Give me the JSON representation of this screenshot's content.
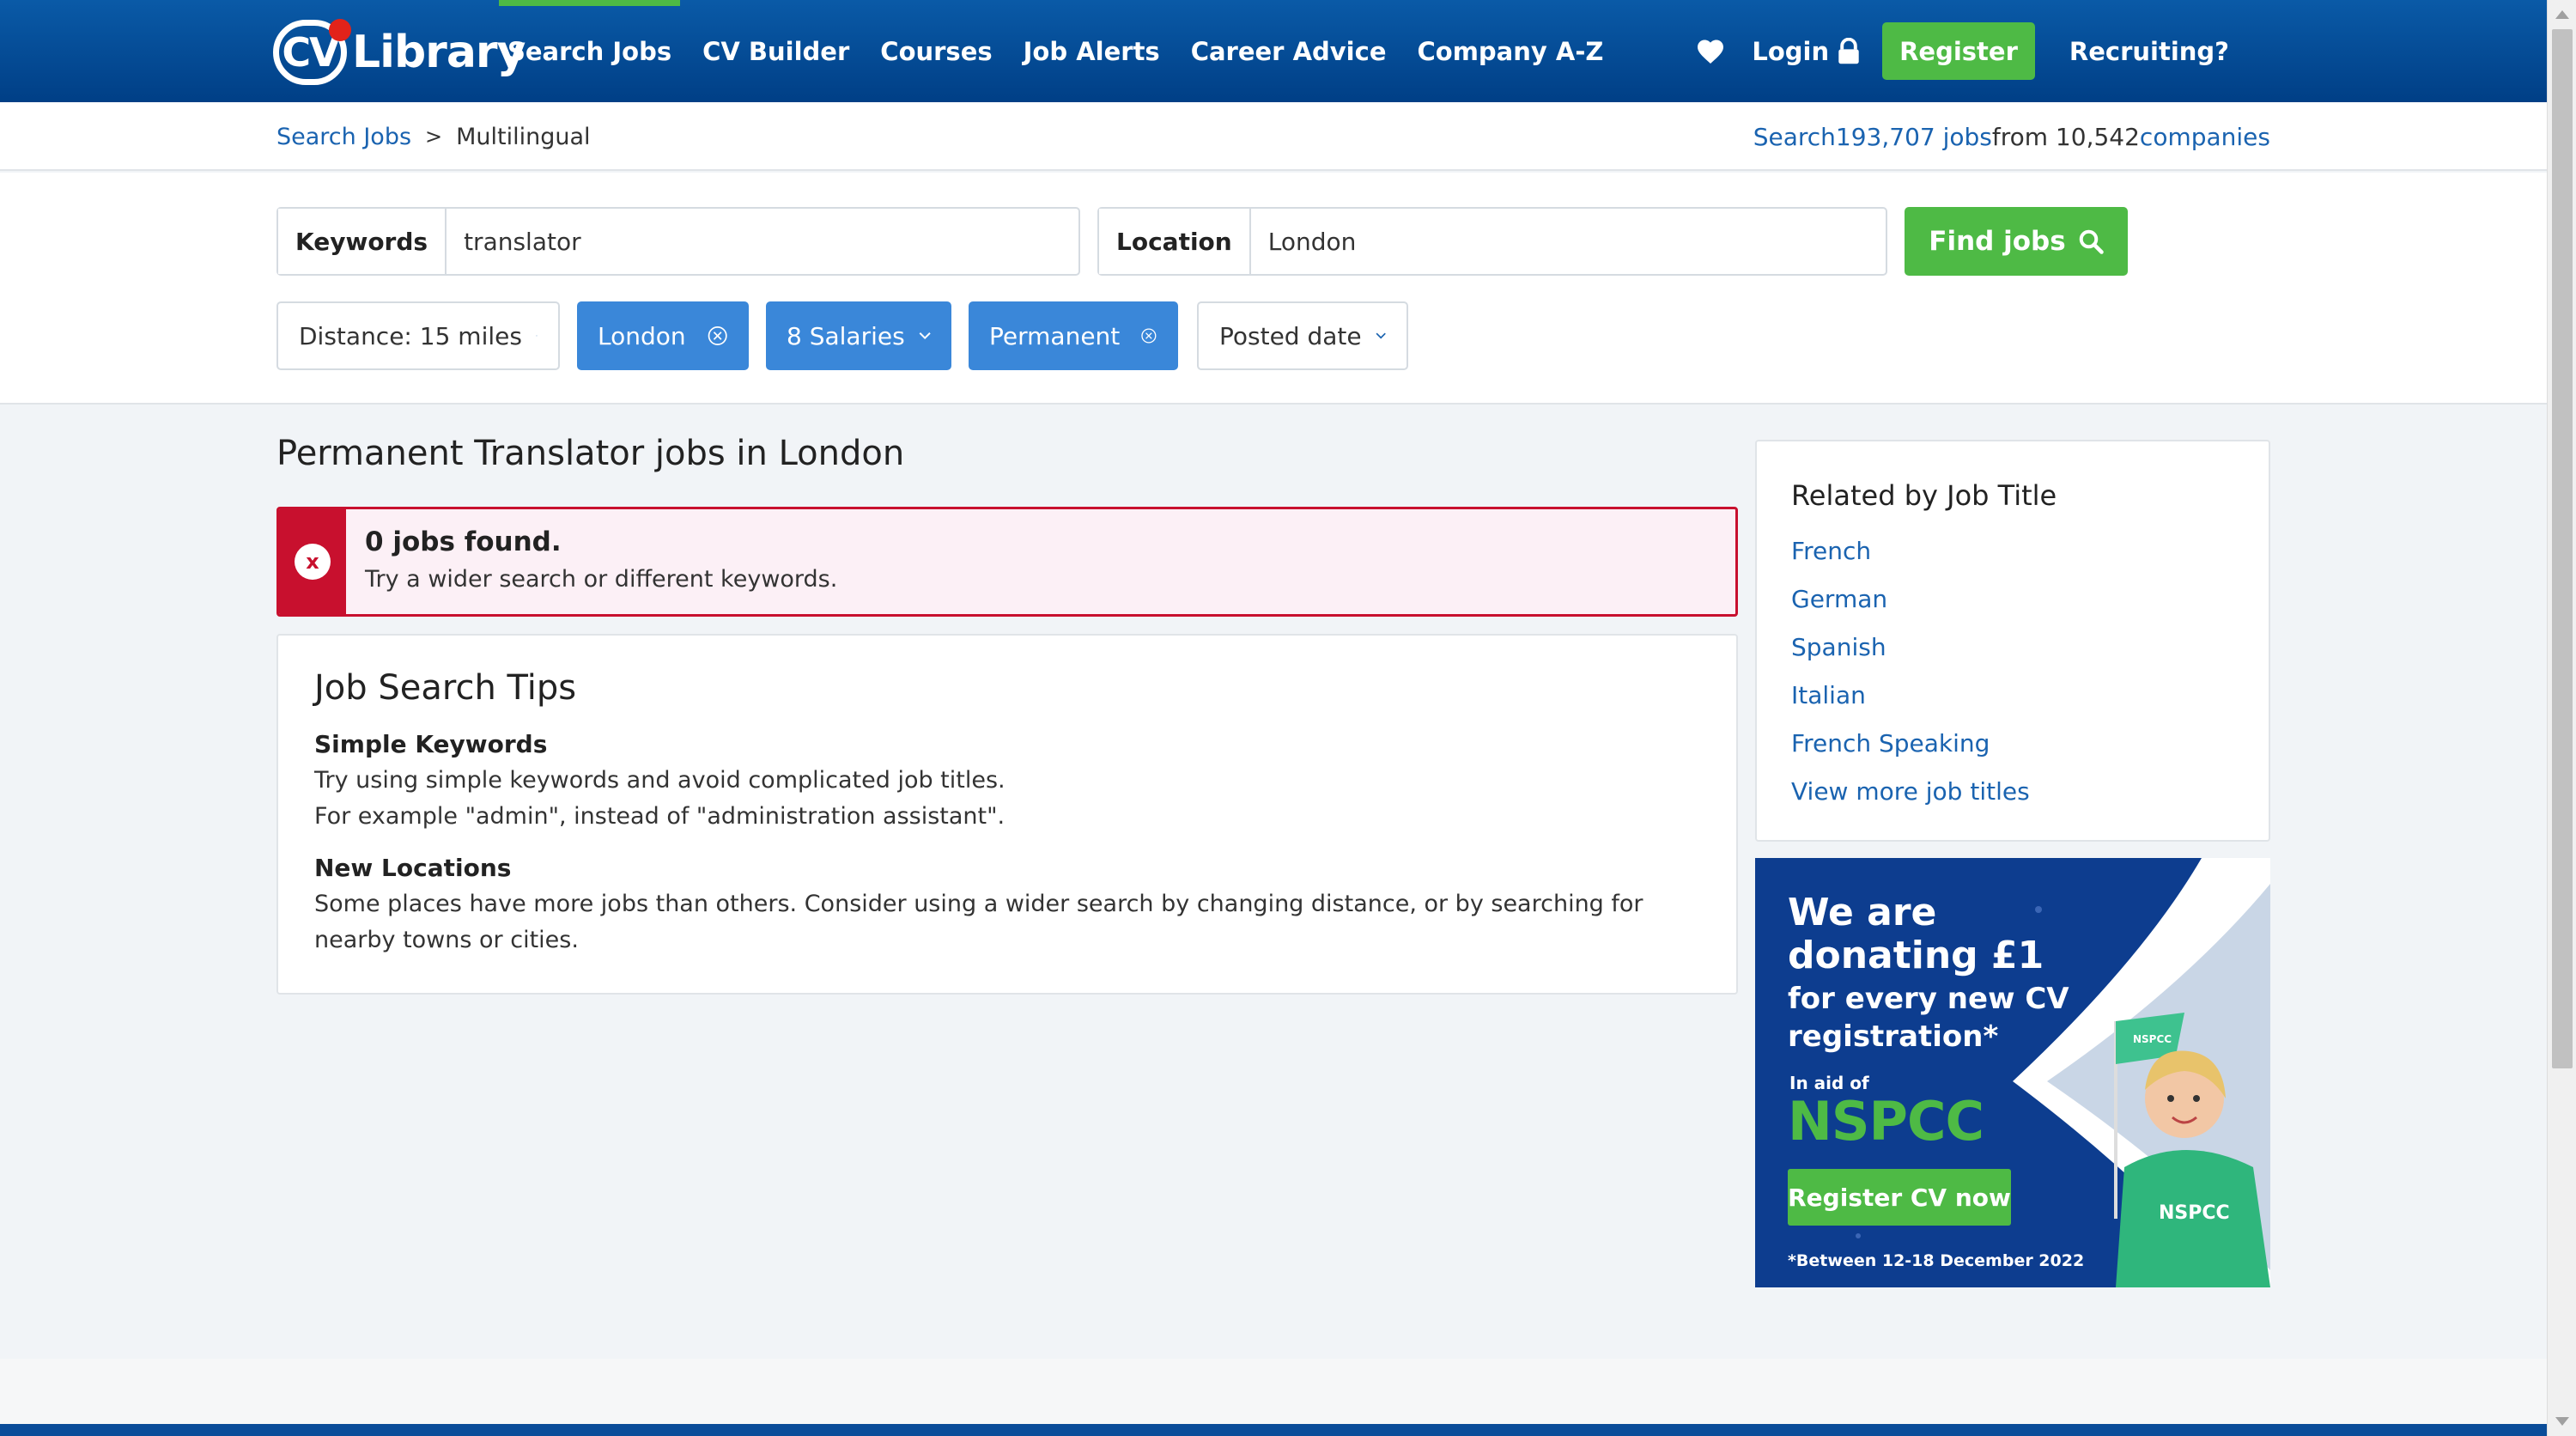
{
  "nav": {
    "logo_alt": "CV Library",
    "links": [
      "Search Jobs",
      "CV Builder",
      "Courses",
      "Job Alerts",
      "Career Advice",
      "Company A-Z"
    ],
    "login": "Login",
    "register": "Register",
    "recruiting": "Recruiting?"
  },
  "breadcrumb": {
    "link": "Search Jobs",
    "separator": ">",
    "current": "Multilingual"
  },
  "stats": {
    "prefix": "Search",
    "jobs_count": "193,707 jobs",
    "middle": "from 10,542",
    "companies": "companies"
  },
  "search": {
    "keywords_label": "Keywords",
    "keywords_value": "translator",
    "location_label": "Location",
    "location_value": "London",
    "find_button": "Find jobs"
  },
  "filters": {
    "distance": "Distance: 15 miles",
    "location": "London",
    "salaries": "8 Salaries",
    "type": "Permanent",
    "posted": "Posted date"
  },
  "results": {
    "title": "Permanent Translator jobs in London",
    "alert_title": "0 jobs found.",
    "alert_msg": "Try a wider search or different keywords."
  },
  "tips": {
    "title": "Job Search Tips",
    "h1": "Simple Keywords",
    "p1a": "Try using simple keywords and avoid complicated job titles.",
    "p1b": "For example \"admin\", instead of \"administration assistant\".",
    "h2": "New Locations",
    "p2": "Some places have more jobs than others. Consider using a wider search by changing distance, or by searching for nearby towns or cities."
  },
  "related": {
    "title": "Related by Job Title",
    "items": [
      "French",
      "German",
      "Spanish",
      "Italian",
      "French Speaking",
      "View more job titles"
    ]
  },
  "ad": {
    "line1": "We are",
    "line2": "donating £1",
    "line3": "for every new CV",
    "line4": "registration*",
    "aid": "In aid of",
    "charity": "NSPCC",
    "button": "Register CV now",
    "footnote": "*Between 12-18 December 2022",
    "shirt_text": "NSPCC",
    "flag_text": "NSPCC"
  },
  "colors": {
    "brand_blue": "#0a5aa7",
    "accent_green": "#4eba45",
    "link_blue": "#1a63b0",
    "error_red": "#c8102e",
    "filter_blue": "#3a87d9"
  }
}
